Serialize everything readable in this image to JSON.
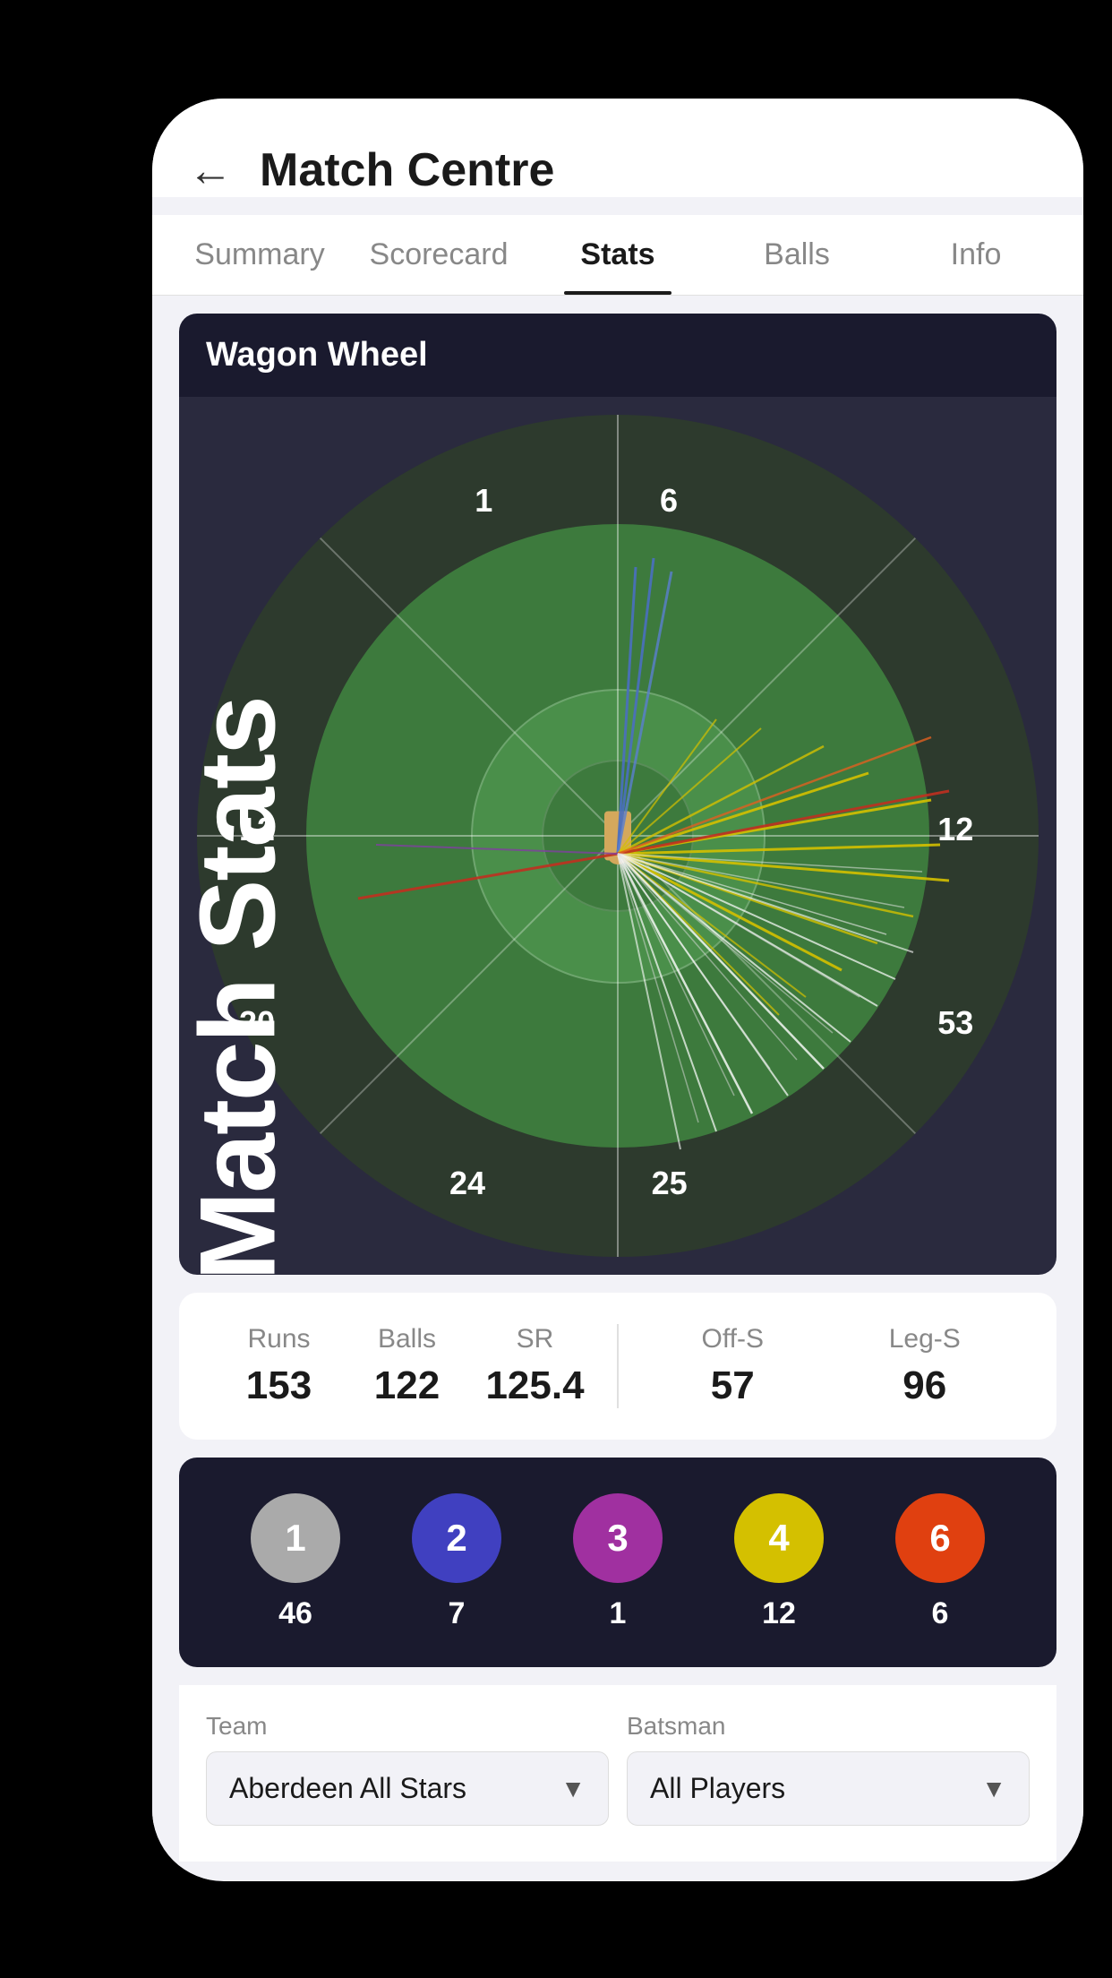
{
  "side_title": "Match Stats",
  "header": {
    "back_label": "←",
    "title": "Match Centre"
  },
  "tabs": [
    {
      "id": "summary",
      "label": "Summary",
      "active": false
    },
    {
      "id": "scorecard",
      "label": "Scorecard",
      "active": false
    },
    {
      "id": "stats",
      "label": "Stats",
      "active": true
    },
    {
      "id": "balls",
      "label": "Balls",
      "active": false
    },
    {
      "id": "info",
      "label": "Info",
      "active": false
    }
  ],
  "wagon_wheel": {
    "title": "Wagon Wheel",
    "sectors": {
      "top_left": "1",
      "top_right": "6",
      "mid_left": "12",
      "mid_right": "12",
      "bot_left": "20",
      "bot_right": "53",
      "bottom_left": "24",
      "bottom_right": "25"
    }
  },
  "stats": {
    "runs_label": "Runs",
    "runs_value": "153",
    "balls_label": "Balls",
    "balls_value": "122",
    "sr_label": "SR",
    "sr_value": "125.4",
    "offs_label": "Off-S",
    "offs_value": "57",
    "legs_label": "Leg-S",
    "legs_value": "96"
  },
  "score_balls": [
    {
      "label": "1",
      "count": "46",
      "class": "ball-1"
    },
    {
      "label": "2",
      "count": "7",
      "class": "ball-2"
    },
    {
      "label": "3",
      "count": "1",
      "class": "ball-3"
    },
    {
      "label": "4",
      "count": "12",
      "class": "ball-4"
    },
    {
      "label": "6",
      "count": "6",
      "class": "ball-6"
    }
  ],
  "team_dropdown": {
    "label": "Team",
    "value": "Aberdeen All Stars"
  },
  "batsman_dropdown": {
    "label": "Batsman",
    "value": "All Players"
  }
}
